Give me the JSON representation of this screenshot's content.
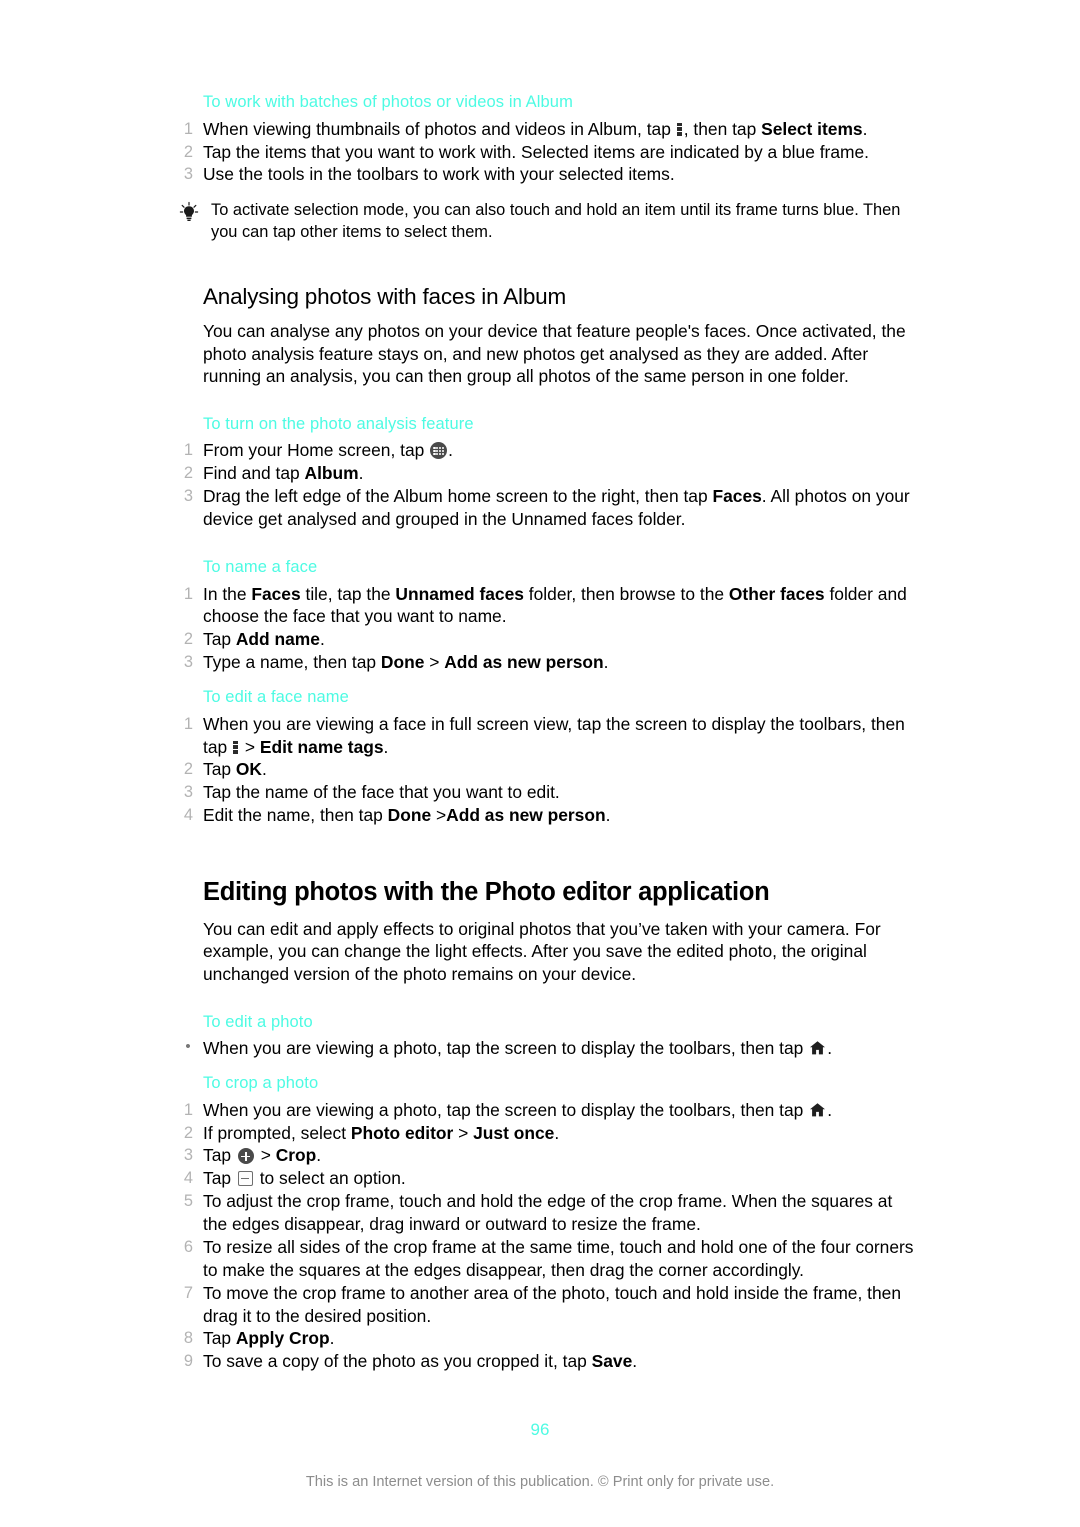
{
  "page": {
    "number": "96",
    "footer_note": "This is an Internet version of this publication. © Print only for private use."
  },
  "colors": {
    "heading_accent": "#4dfbe3",
    "body_text": "#000000",
    "step_number": "#b3b3b3",
    "footer_text": "#8d8d8d"
  },
  "sections": {
    "batches": {
      "heading": "To work with batches of photos or videos in Album",
      "steps": [
        {
          "num": "1",
          "parts": [
            {
              "type": "text",
              "value": "When viewing thumbnails of photos and videos in Album, tap "
            },
            {
              "type": "icon",
              "value": "kebab-menu-icon"
            },
            {
              "type": "text",
              "value": ", then tap "
            },
            {
              "type": "bold",
              "value": "Select items"
            },
            {
              "type": "text",
              "value": "."
            }
          ]
        },
        {
          "num": "2",
          "parts": [
            {
              "type": "text",
              "value": "Tap the items that you want to work with. Selected items are indicated by a blue frame."
            }
          ]
        },
        {
          "num": "3",
          "parts": [
            {
              "type": "text",
              "value": "Use the tools in the toolbars to work with your selected items."
            }
          ]
        }
      ],
      "tip": "To activate selection mode, you can also touch and hold an item until its frame turns blue. Then you can tap other items to select them.",
      "tip_icon": "lightbulb-tip-icon"
    },
    "analysing": {
      "heading": "Analysing photos with faces in Album",
      "intro": "You can analyse any photos on your device that feature people's faces. Once activated, the photo analysis feature stays on, and new photos get analysed as they are added. After running an analysis, you can then group all photos of the same person in one folder."
    },
    "turn_on_analysis": {
      "heading": "To turn on the photo analysis feature",
      "steps": [
        {
          "num": "1",
          "parts": [
            {
              "type": "text",
              "value": "From your Home screen, tap "
            },
            {
              "type": "icon",
              "value": "app-drawer-icon"
            },
            {
              "type": "text",
              "value": "."
            }
          ]
        },
        {
          "num": "2",
          "parts": [
            {
              "type": "text",
              "value": "Find and tap "
            },
            {
              "type": "bold",
              "value": "Album"
            },
            {
              "type": "text",
              "value": "."
            }
          ]
        },
        {
          "num": "3",
          "parts": [
            {
              "type": "text",
              "value": "Drag the left edge of the Album home screen to the right, then tap "
            },
            {
              "type": "bold",
              "value": "Faces"
            },
            {
              "type": "text",
              "value": ". All photos on your device get analysed and grouped in the Unnamed faces folder."
            }
          ]
        }
      ]
    },
    "name_a_face": {
      "heading": "To name a face",
      "steps": [
        {
          "num": "1",
          "parts": [
            {
              "type": "text",
              "value": "In the "
            },
            {
              "type": "bold",
              "value": "Faces"
            },
            {
              "type": "text",
              "value": " tile, tap the "
            },
            {
              "type": "bold",
              "value": "Unnamed faces"
            },
            {
              "type": "text",
              "value": " folder, then browse to the "
            },
            {
              "type": "bold",
              "value": "Other faces"
            },
            {
              "type": "text",
              "value": " folder and choose the face that you want to name."
            }
          ]
        },
        {
          "num": "2",
          "parts": [
            {
              "type": "text",
              "value": "Tap "
            },
            {
              "type": "bold",
              "value": "Add name"
            },
            {
              "type": "text",
              "value": "."
            }
          ]
        },
        {
          "num": "3",
          "parts": [
            {
              "type": "text",
              "value": "Type a name, then tap "
            },
            {
              "type": "bold",
              "value": "Done"
            },
            {
              "type": "text",
              "value": " > "
            },
            {
              "type": "bold",
              "value": "Add as new person"
            },
            {
              "type": "text",
              "value": "."
            }
          ]
        }
      ]
    },
    "edit_face_name": {
      "heading": "To edit a face name",
      "steps": [
        {
          "num": "1",
          "parts": [
            {
              "type": "text",
              "value": "When you are viewing a face in full screen view, tap the screen to display the toolbars, then tap "
            },
            {
              "type": "icon",
              "value": "kebab-menu-icon"
            },
            {
              "type": "text",
              "value": " > "
            },
            {
              "type": "bold",
              "value": "Edit name tags"
            },
            {
              "type": "text",
              "value": "."
            }
          ]
        },
        {
          "num": "2",
          "parts": [
            {
              "type": "text",
              "value": "Tap "
            },
            {
              "type": "bold",
              "value": "OK"
            },
            {
              "type": "text",
              "value": "."
            }
          ]
        },
        {
          "num": "3",
          "parts": [
            {
              "type": "text",
              "value": "Tap the name of the face that you want to edit."
            }
          ]
        },
        {
          "num": "4",
          "parts": [
            {
              "type": "text",
              "value": "Edit the name, then tap "
            },
            {
              "type": "bold",
              "value": "Done"
            },
            {
              "type": "text",
              "value": " >"
            },
            {
              "type": "bold",
              "value": "Add as new person"
            },
            {
              "type": "text",
              "value": "."
            }
          ]
        }
      ]
    },
    "photo_editor": {
      "heading": "Editing photos with the Photo editor application",
      "intro": "You can edit and apply effects to original photos that you’ve taken with your camera. For example, you can change the light effects. After you save the edited photo, the original unchanged version of the photo remains on your device."
    },
    "edit_a_photo": {
      "heading": "To edit a photo",
      "steps": [
        {
          "num": "•",
          "bullet": true,
          "parts": [
            {
              "type": "text",
              "value": "When you are viewing a photo, tap the screen to display the toolbars, then tap "
            },
            {
              "type": "icon",
              "value": "home-icon"
            },
            {
              "type": "text",
              "value": "."
            }
          ]
        }
      ]
    },
    "crop_a_photo": {
      "heading": "To crop a photo",
      "steps": [
        {
          "num": "1",
          "parts": [
            {
              "type": "text",
              "value": "When you are viewing a photo, tap the screen to display the toolbars, then tap "
            },
            {
              "type": "icon",
              "value": "home-icon"
            },
            {
              "type": "text",
              "value": "."
            }
          ]
        },
        {
          "num": "2",
          "parts": [
            {
              "type": "text",
              "value": "If prompted, select "
            },
            {
              "type": "bold",
              "value": "Photo editor"
            },
            {
              "type": "text",
              "value": " > "
            },
            {
              "type": "bold",
              "value": "Just once"
            },
            {
              "type": "text",
              "value": "."
            }
          ]
        },
        {
          "num": "3",
          "parts": [
            {
              "type": "text",
              "value": "Tap "
            },
            {
              "type": "icon",
              "value": "plus-circle-icon"
            },
            {
              "type": "text",
              "value": " > "
            },
            {
              "type": "bold",
              "value": "Crop"
            },
            {
              "type": "text",
              "value": "."
            }
          ]
        },
        {
          "num": "4",
          "parts": [
            {
              "type": "text",
              "value": "Tap "
            },
            {
              "type": "icon",
              "value": "option-box-icon"
            },
            {
              "type": "text",
              "value": " to select an option."
            }
          ]
        },
        {
          "num": "5",
          "parts": [
            {
              "type": "text",
              "value": "To adjust the crop frame, touch and hold the edge of the crop frame. When the squares at the edges disappear, drag inward or outward to resize the frame."
            }
          ]
        },
        {
          "num": "6",
          "parts": [
            {
              "type": "text",
              "value": "To resize all sides of the crop frame at the same time, touch and hold one of the four corners to make the squares at the edges disappear, then drag the corner accordingly."
            }
          ]
        },
        {
          "num": "7",
          "parts": [
            {
              "type": "text",
              "value": "To move the crop frame to another area of the photo, touch and hold inside the frame, then drag it to the desired position."
            }
          ]
        },
        {
          "num": "8",
          "parts": [
            {
              "type": "text",
              "value": "Tap "
            },
            {
              "type": "bold",
              "value": "Apply Crop"
            },
            {
              "type": "text",
              "value": "."
            }
          ]
        },
        {
          "num": "9",
          "parts": [
            {
              "type": "text",
              "value": "To save a copy of the photo as you cropped it, tap "
            },
            {
              "type": "bold",
              "value": "Save"
            },
            {
              "type": "text",
              "value": "."
            }
          ]
        }
      ]
    }
  }
}
